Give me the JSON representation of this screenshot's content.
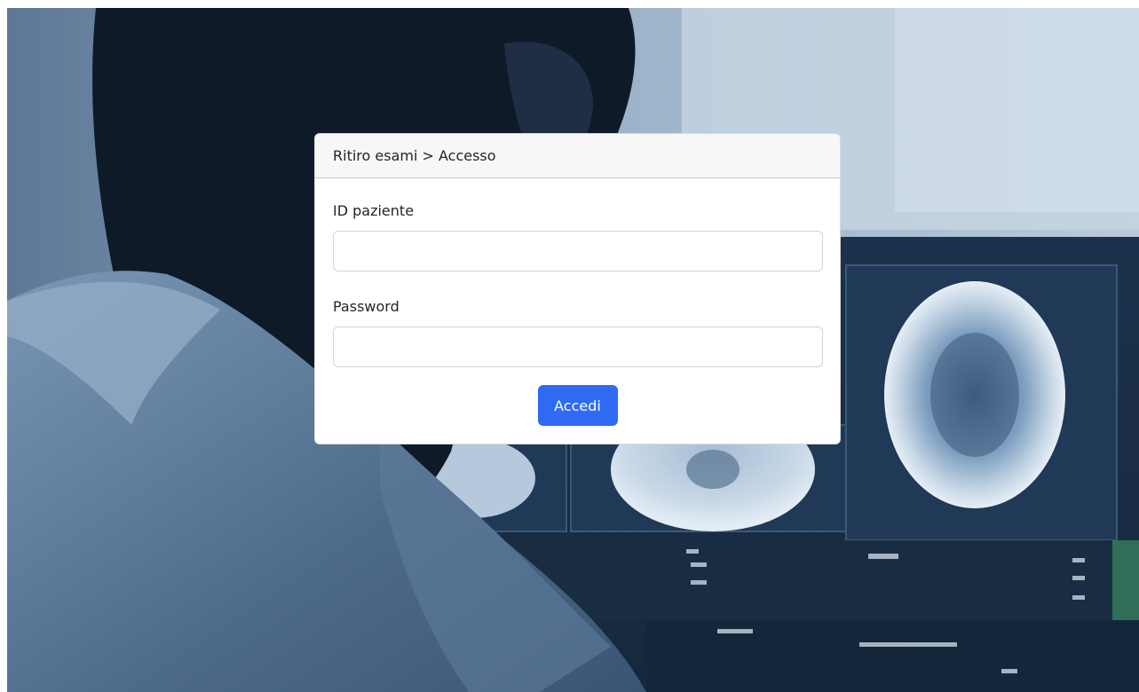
{
  "breadcrumb": {
    "text": "Ritiro esami > Accesso"
  },
  "form": {
    "patient_id_label": "ID paziente",
    "patient_id_value": "",
    "password_label": "Password",
    "password_value": "",
    "submit_label": "Accedi"
  },
  "colors": {
    "primary_button": "#2f6bf2",
    "header_background": "#f7f7f7",
    "background_tint": "#3a5573"
  }
}
